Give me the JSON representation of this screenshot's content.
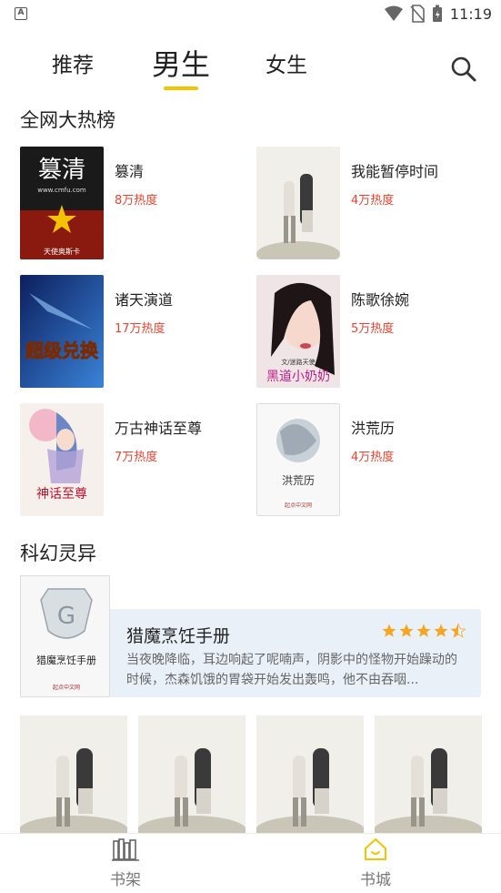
{
  "status_bar": {
    "time": "11:19",
    "app_badge": "A"
  },
  "tabs": [
    {
      "label": "推荐",
      "active": false
    },
    {
      "label": "男生",
      "active": true
    },
    {
      "label": "女生",
      "active": false
    }
  ],
  "accent_color": "#f5c400",
  "heat_color": "#e8432f",
  "hot_section": {
    "title": "全网大热榜",
    "books": [
      {
        "name": "篡清",
        "heat": "8万热度"
      },
      {
        "name": "我能暂停时间",
        "heat": "4万热度"
      },
      {
        "name": "诸天演道",
        "heat": "17万热度"
      },
      {
        "name": "陈歌徐婉",
        "heat": "5万热度"
      },
      {
        "name": "万古神话至尊",
        "heat": "7万热度"
      },
      {
        "name": "洪荒历",
        "heat": "4万热度"
      }
    ]
  },
  "covers": {
    "c1_title": "篡清",
    "c1_sub": "天使奥斯卡",
    "c1_url": "www.cmfu.com",
    "c3_title": "超级兑换",
    "c4_author": "文/迷路天使",
    "c4_title": "黑道小奶奶",
    "c5_title": "神话至尊",
    "c6_title": "洪荒历",
    "c6_pub": "起点中文网",
    "f_title": "猎魔烹饪手册",
    "f_pub": "起点中文网"
  },
  "scifi_section": {
    "title": "科幻灵异",
    "featured": {
      "title": "猎魔烹饪手册",
      "rating": 4.5,
      "description": "当夜晚降临，耳边响起了呢喃声，阴影中的怪物开始躁动的时候，杰森饥饿的胃袋开始发出轰鸣，他不由吞咽..."
    }
  },
  "bottom_nav": [
    {
      "label": "书架",
      "icon": "bookshelf-icon",
      "active": false
    },
    {
      "label": "书城",
      "icon": "home-icon",
      "active": true
    }
  ]
}
